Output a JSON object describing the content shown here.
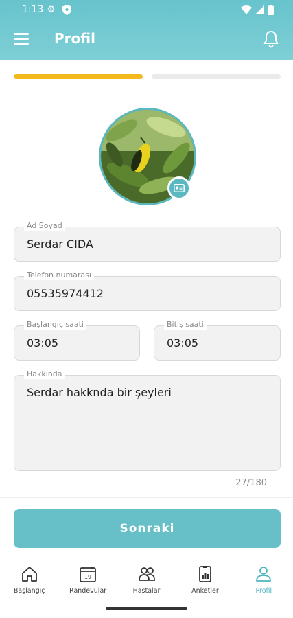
{
  "status_bar": {
    "time": "1:13"
  },
  "header": {
    "title": "Profil"
  },
  "progress": {
    "current_step": 1,
    "total_steps": 2
  },
  "colors": {
    "accent": "#67bfc7",
    "progress": "#f3b81c",
    "header": "#67c3cc"
  },
  "form": {
    "name": {
      "label": "Ad Soyad",
      "value": "Serdar CIDA"
    },
    "phone": {
      "label": "Telefon numarası",
      "value": "05535974412"
    },
    "start_time": {
      "label": "Başlangıç saati",
      "value": "03:05"
    },
    "end_time": {
      "label": "Bitiş saati",
      "value": "03:05"
    },
    "about": {
      "label": "Hakkında",
      "value": "Serdar hakknda bir şeyleri"
    },
    "counter": "27/180"
  },
  "next_button": "Sonraki",
  "nav": [
    {
      "label": "Başlangıç",
      "icon": "home-icon"
    },
    {
      "label": "Randevular",
      "icon": "calendar-icon"
    },
    {
      "label": "Hastalar",
      "icon": "users-icon"
    },
    {
      "label": "Anketler",
      "icon": "chart-icon"
    },
    {
      "label": "Profil",
      "icon": "profile-icon",
      "active": true
    }
  ]
}
